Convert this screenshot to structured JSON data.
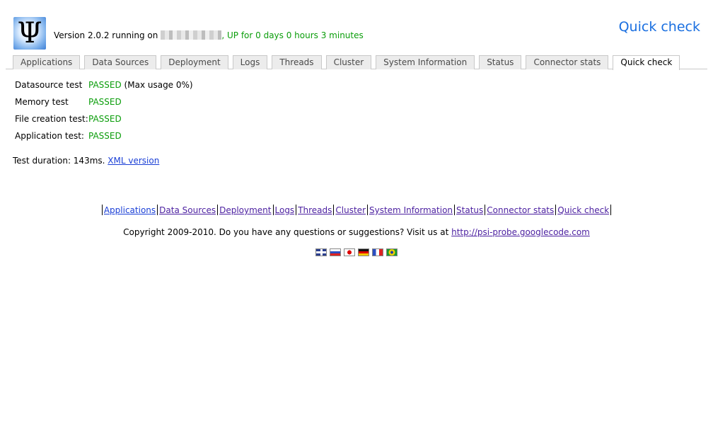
{
  "header": {
    "logo_glyph": "Ψ",
    "version_prefix": "Version 2.0.2 running on",
    "hostname_redacted": true,
    "uptime": ", UP for 0 days 0 hours 3 minutes",
    "page_title": "Quick check"
  },
  "tabs": [
    {
      "label": "Applications",
      "active": false
    },
    {
      "label": "Data Sources",
      "active": false
    },
    {
      "label": "Deployment",
      "active": false
    },
    {
      "label": "Logs",
      "active": false
    },
    {
      "label": "Threads",
      "active": false
    },
    {
      "label": "Cluster",
      "active": false
    },
    {
      "label": "System Information",
      "active": false
    },
    {
      "label": "Status",
      "active": false
    },
    {
      "label": "Connector stats",
      "active": false
    },
    {
      "label": "Quick check",
      "active": true
    }
  ],
  "results": [
    {
      "label": "Datasource test",
      "status": "PASSED",
      "note": " (Max usage 0%)"
    },
    {
      "label": "Memory test",
      "status": "PASSED",
      "note": ""
    },
    {
      "label": "File creation test:",
      "status": "PASSED",
      "note": ""
    },
    {
      "label": "Application test:",
      "status": "PASSED",
      "note": ""
    }
  ],
  "duration": {
    "text": "Test duration: 143ms.",
    "xml_link": "XML version"
  },
  "footer": {
    "links": [
      "Applications",
      "Data Sources",
      "Deployment",
      "Logs",
      "Threads",
      "Cluster",
      "System Information",
      "Status",
      "Connector stats",
      "Quick check"
    ],
    "copyright_text": "Copyright 2009-2010. Do you have any questions or suggestions? Visit us at",
    "copyright_link": "http://psi-probe.googlecode.com",
    "flags": [
      "uk-flag-icon",
      "russia-flag-icon",
      "japan-flag-icon",
      "germany-flag-icon",
      "france-flag-icon",
      "brazil-flag-icon"
    ]
  },
  "colors": {
    "passed": "#0a9d0a",
    "heading": "#1a6fe0",
    "link": "#1a3fd6",
    "visited_link": "#4b1fa0"
  }
}
